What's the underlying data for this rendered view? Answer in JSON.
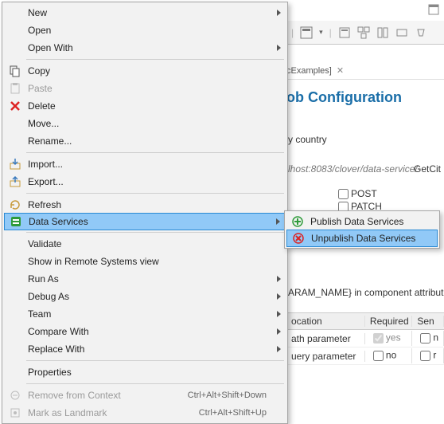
{
  "background": {
    "tab_label": "cExamples]",
    "heading": "ob Configuration",
    "label": "y country",
    "url_host": "lhost:8083/clover/data-service/",
    "url_path": "GetCit",
    "check_post": "POST",
    "check_patch": "PATCH",
    "attr_note": "ARAM_NAME} in component attribut",
    "grid": {
      "headers": {
        "location": "ocation",
        "required": "Required",
        "sensitive": "Sen"
      },
      "rows": [
        {
          "location": "ath parameter",
          "required": "yes",
          "req_checked": true,
          "req_disabled": true,
          "sensitive": "n"
        },
        {
          "location": "uery parameter",
          "required": "no",
          "req_checked": false,
          "req_disabled": false,
          "sensitive": "r"
        }
      ]
    }
  },
  "menu": {
    "items": [
      {
        "label": "New",
        "submenu": true
      },
      {
        "label": "Open"
      },
      {
        "label": "Open With",
        "submenu": true
      },
      {
        "sep": true
      },
      {
        "label": "Copy",
        "icon": "copy"
      },
      {
        "label": "Paste",
        "icon": "paste",
        "disabled": true
      },
      {
        "label": "Delete",
        "icon": "delete"
      },
      {
        "label": "Move..."
      },
      {
        "label": "Rename..."
      },
      {
        "sep": true
      },
      {
        "label": "Import...",
        "icon": "import"
      },
      {
        "label": "Export...",
        "icon": "export"
      },
      {
        "sep": true
      },
      {
        "label": "Refresh",
        "icon": "refresh"
      },
      {
        "label": "Data Services",
        "icon": "data-services",
        "submenu": true,
        "highlight": true
      },
      {
        "sep": true
      },
      {
        "label": "Validate"
      },
      {
        "label": "Show in Remote Systems view"
      },
      {
        "label": "Run As",
        "submenu": true
      },
      {
        "label": "Debug As",
        "submenu": true
      },
      {
        "label": "Team",
        "submenu": true
      },
      {
        "label": "Compare With",
        "submenu": true
      },
      {
        "label": "Replace With",
        "submenu": true
      },
      {
        "sep": true
      },
      {
        "label": "Properties"
      },
      {
        "sep": true
      },
      {
        "label": "Remove from Context",
        "icon": "remove-context",
        "disabled": true,
        "accel": "Ctrl+Alt+Shift+Down"
      },
      {
        "label": "Mark as Landmark",
        "icon": "landmark",
        "disabled": true,
        "accel": "Ctrl+Alt+Shift+Up"
      }
    ]
  },
  "submenu": {
    "items": [
      {
        "label": "Publish Data Services",
        "icon": "publish"
      },
      {
        "label": "Unpublish Data Services",
        "icon": "unpublish",
        "highlight": true
      }
    ]
  }
}
